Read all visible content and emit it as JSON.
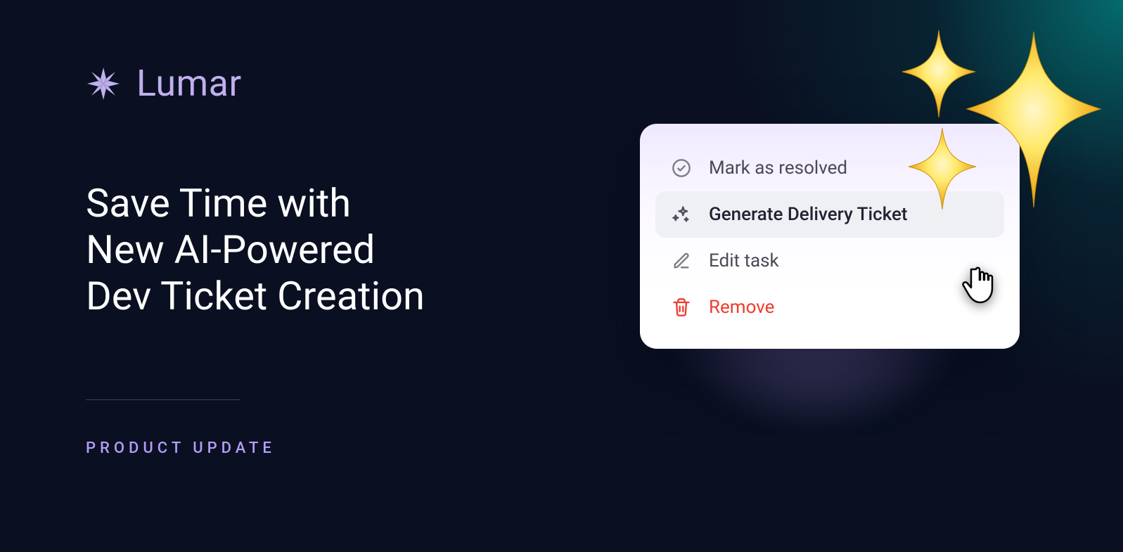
{
  "brand": {
    "name": "Lumar"
  },
  "headline": {
    "line1": "Save Time with",
    "line2": "New AI-Powered",
    "line3": "Dev Ticket Creation"
  },
  "kicker": "PRODUCT UPDATE",
  "menu": {
    "items": [
      {
        "label": "Mark as resolved"
      },
      {
        "label": "Generate Delivery Ticket"
      },
      {
        "label": "Edit task"
      },
      {
        "label": "Remove"
      }
    ]
  },
  "colors": {
    "accent": "#b49df5",
    "danger": "#ef3b2d",
    "bg": "#0a1022"
  }
}
